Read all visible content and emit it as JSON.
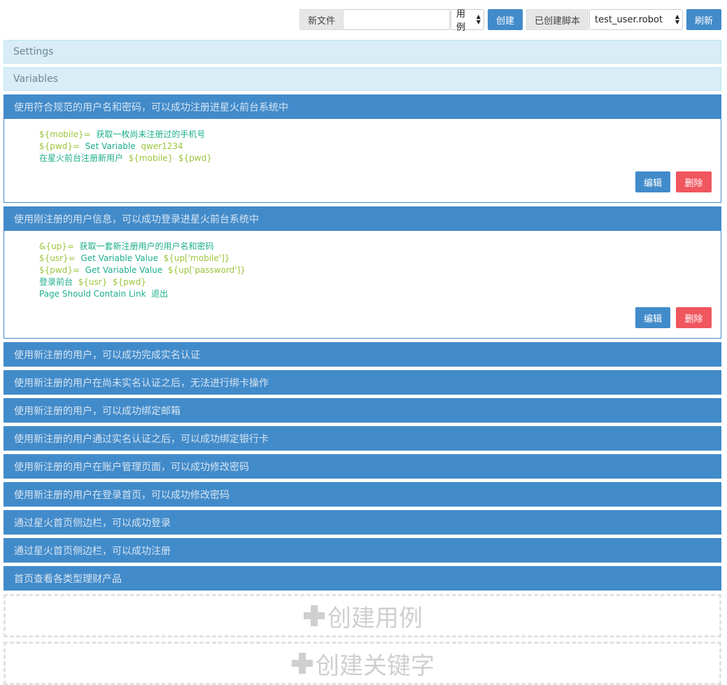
{
  "toolbar": {
    "new_file_label": "新文件",
    "new_file_value": "",
    "type_select": "用例",
    "create_button": "创建",
    "created_scripts_label": "已创建脚本",
    "script_select": "test_user.robot",
    "refresh_button": "刷新"
  },
  "sections": {
    "settings": "Settings",
    "variables": "Variables"
  },
  "cases": [
    {
      "title": "使用符合规范的用户名和密码，可以成功注册进星火前台系统中",
      "steps": [
        [
          {
            "t": "var",
            "v": "${mobile}="
          },
          {
            "t": "kw",
            "v": "获取一枚尚未注册过的手机号"
          }
        ],
        [
          {
            "t": "var",
            "v": "${pwd}="
          },
          {
            "t": "kw",
            "v": "Set Variable"
          },
          {
            "t": "arg",
            "v": "qwer1234"
          }
        ],
        [
          {
            "t": "kw",
            "v": "在星火前台注册新用户"
          },
          {
            "t": "arg",
            "v": "${mobile}"
          },
          {
            "t": "arg",
            "v": "${pwd}"
          }
        ]
      ]
    },
    {
      "title": "使用刚注册的用户信息，可以成功登录进星火前台系统中",
      "steps": [
        [
          {
            "t": "var",
            "v": "&{up}="
          },
          {
            "t": "kw",
            "v": "获取一套新注册用户的用户名和密码"
          }
        ],
        [
          {
            "t": "var",
            "v": "${usr}="
          },
          {
            "t": "kw",
            "v": "Get Variable Value"
          },
          {
            "t": "arg",
            "v": "${up['mobile']}"
          }
        ],
        [
          {
            "t": "var",
            "v": "${pwd}="
          },
          {
            "t": "kw",
            "v": "Get Variable Value"
          },
          {
            "t": "arg",
            "v": "${up['password']}"
          }
        ],
        [
          {
            "t": "kw",
            "v": "登录前台"
          },
          {
            "t": "arg",
            "v": "${usr}"
          },
          {
            "t": "arg",
            "v": "${pwd}"
          }
        ],
        [
          {
            "t": "kw",
            "v": "Page Should Contain Link"
          },
          {
            "t": "kw",
            "v": "退出"
          }
        ]
      ]
    }
  ],
  "case_actions": {
    "edit": "编辑",
    "delete": "删除"
  },
  "collapsed_cases": [
    "使用新注册的用户，可以成功完成实名认证",
    "使用新注册的用户在尚未实名认证之后，无法进行绑卡操作",
    "使用新注册的用户，可以成功绑定邮箱",
    "使用新注册的用户通过实名认证之后，可以成功绑定银行卡",
    "使用新注册的用户在账户管理页面，可以成功修改密码",
    "使用新注册的用户在登录首页，可以成功修改密码",
    "通过星火首页侧边栏，可以成功登录",
    "通过星火首页侧边栏，可以成功注册",
    "首页查看各类型理财产品"
  ],
  "create": {
    "case": "创建用例",
    "keyword": "创建关键字"
  },
  "icons": {
    "plus": "plus-icon",
    "select_arrows": "select-arrows-icon"
  },
  "colors": {
    "primary": "#428bca",
    "danger": "#f0565e",
    "keyword": "#1cae8c",
    "variable": "#9cc53d"
  }
}
